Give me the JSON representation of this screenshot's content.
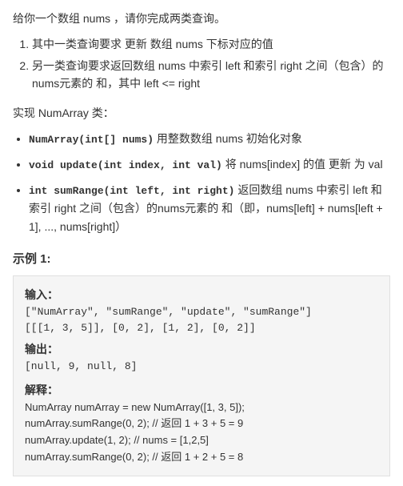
{
  "intro": {
    "line1": "给你一个数组 nums ，请你完成两类查询。",
    "list": [
      "其中一类查询要求 更新 数组 nums 下标对应的值",
      "另一类查询要求返回数组 nums 中索引 left 和索引 right 之间（包含）的nums元素的 和，其中 left <= right"
    ]
  },
  "implement": {
    "title": "实现 NumArray 类：",
    "bullets": [
      {
        "code": "NumArray(int[] nums)",
        "desc": " 用整数数组 nums 初始化对象"
      },
      {
        "code": "void update(int index, int val)",
        "desc": " 将 nums[index] 的值 更新 为 val"
      },
      {
        "code": "int sumRange(int left, int right)",
        "desc": " 返回数组 nums 中索引 left 和索引 right 之间（包含）的nums元素的 和（即，nums[left] + nums[left + 1], ..., nums[right]）"
      }
    ]
  },
  "example": {
    "title": "示例 1:",
    "input_label": "输入：",
    "input_line1": "[\"NumArray\", \"sumRange\", \"update\", \"sumRange\"]",
    "input_line2": "[[[1, 3, 5]], [0, 2], [1, 2], [0, 2]]",
    "output_label": "输出：",
    "output_value": "[null, 9, null, 8]",
    "explain_label": "解释：",
    "explain_lines": [
      "NumArray numArray = new NumArray([1, 3, 5]);",
      "numArray.sumRange(0, 2);  // 返回 1 + 3 + 5 = 9",
      "numArray.update(1, 2);    // nums = [1,2,5]",
      "numArray.sumRange(0, 2);  // 返回 1 + 2 + 5 = 8"
    ]
  }
}
